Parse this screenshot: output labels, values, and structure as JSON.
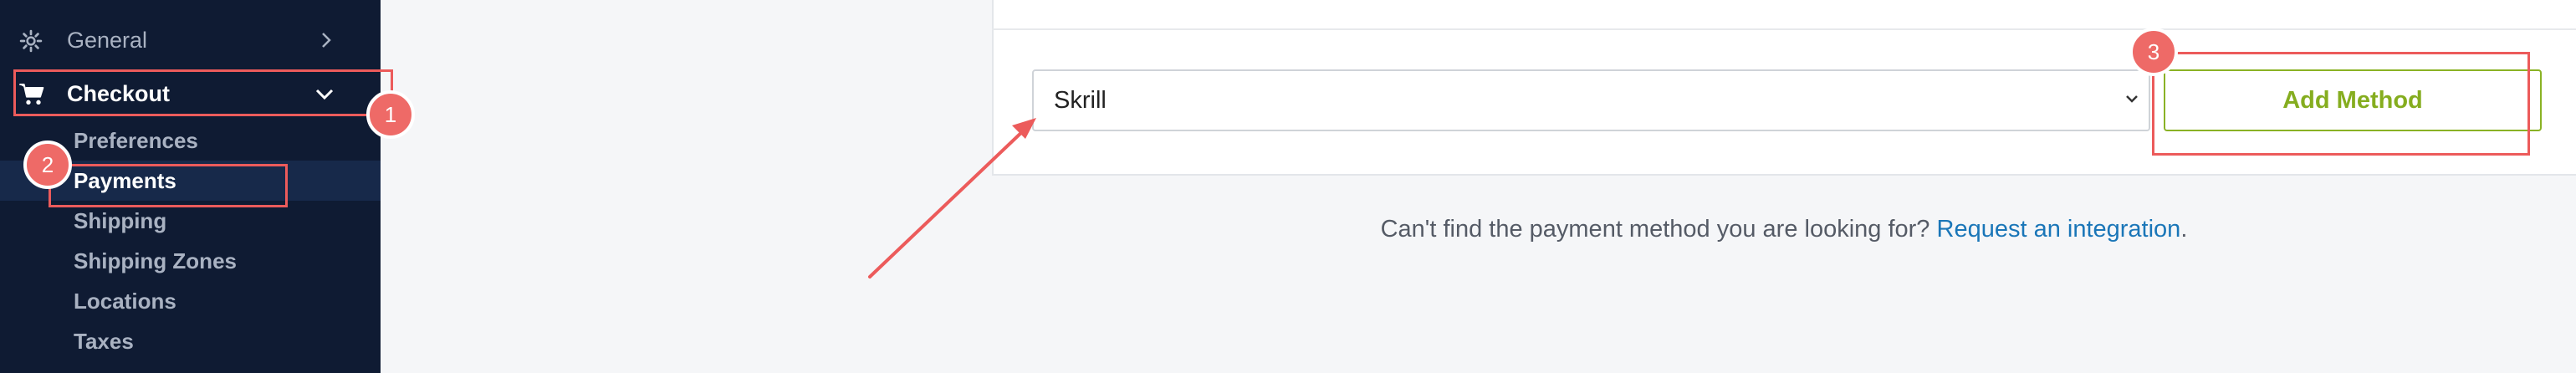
{
  "sidebar": {
    "general_label": "General",
    "checkout_label": "Checkout",
    "sub_items": [
      "Preferences",
      "Payments",
      "Shipping",
      "Shipping Zones",
      "Locations",
      "Taxes"
    ],
    "active_item": "Payments"
  },
  "main": {
    "payment_select_value": "Skrill",
    "add_method_label": "Add Method",
    "help_text": "Can't find the payment method you are looking for?",
    "help_link": "Request an integration",
    "help_suffix": "."
  },
  "annotations": {
    "badges": [
      "1",
      "2",
      "3"
    ],
    "color": "#ee6a67"
  },
  "colors": {
    "sidebar_bg": "#0f1b33",
    "accent_green": "#85ad1f",
    "link_blue": "#1a76b8"
  },
  "icons": {
    "general": "gear-icon",
    "checkout": "cart-icon"
  }
}
